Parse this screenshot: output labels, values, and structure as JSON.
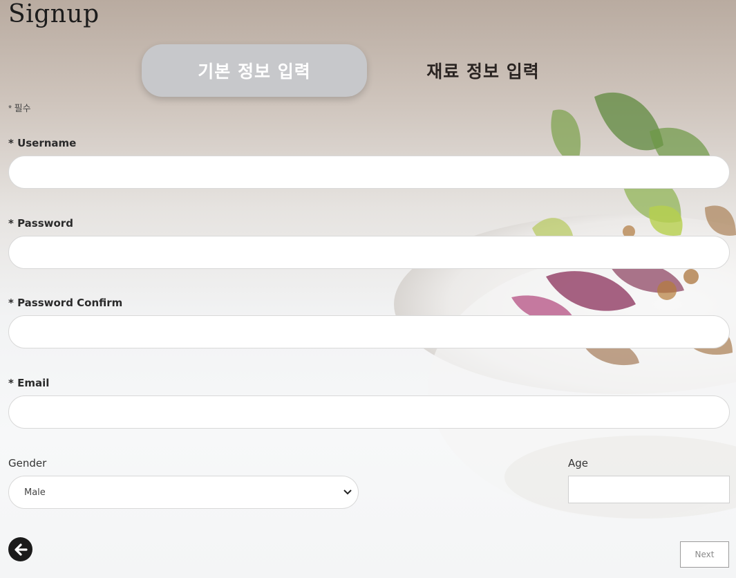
{
  "page": {
    "title": "Signup"
  },
  "tabs": [
    {
      "label": "기본 정보 입력",
      "active": true
    },
    {
      "label": "재료 정보 입력",
      "active": false
    }
  ],
  "form": {
    "required_note": "* 필수",
    "username": {
      "label": "* Username",
      "value": ""
    },
    "password": {
      "label": "* Password",
      "value": ""
    },
    "password_confirm": {
      "label": "* Password Confirm",
      "value": ""
    },
    "email": {
      "label": "* Email",
      "value": ""
    },
    "gender": {
      "label": "Gender",
      "selected": "Male"
    },
    "age": {
      "label": "Age",
      "value": ""
    }
  },
  "actions": {
    "back_icon": "arrow-left-circle-icon",
    "next_label": "Next"
  },
  "colors": {
    "active_tab_bg": "#c7c8cb",
    "active_tab_text": "#ffffff",
    "back_button_bg": "#1b1b1b"
  }
}
